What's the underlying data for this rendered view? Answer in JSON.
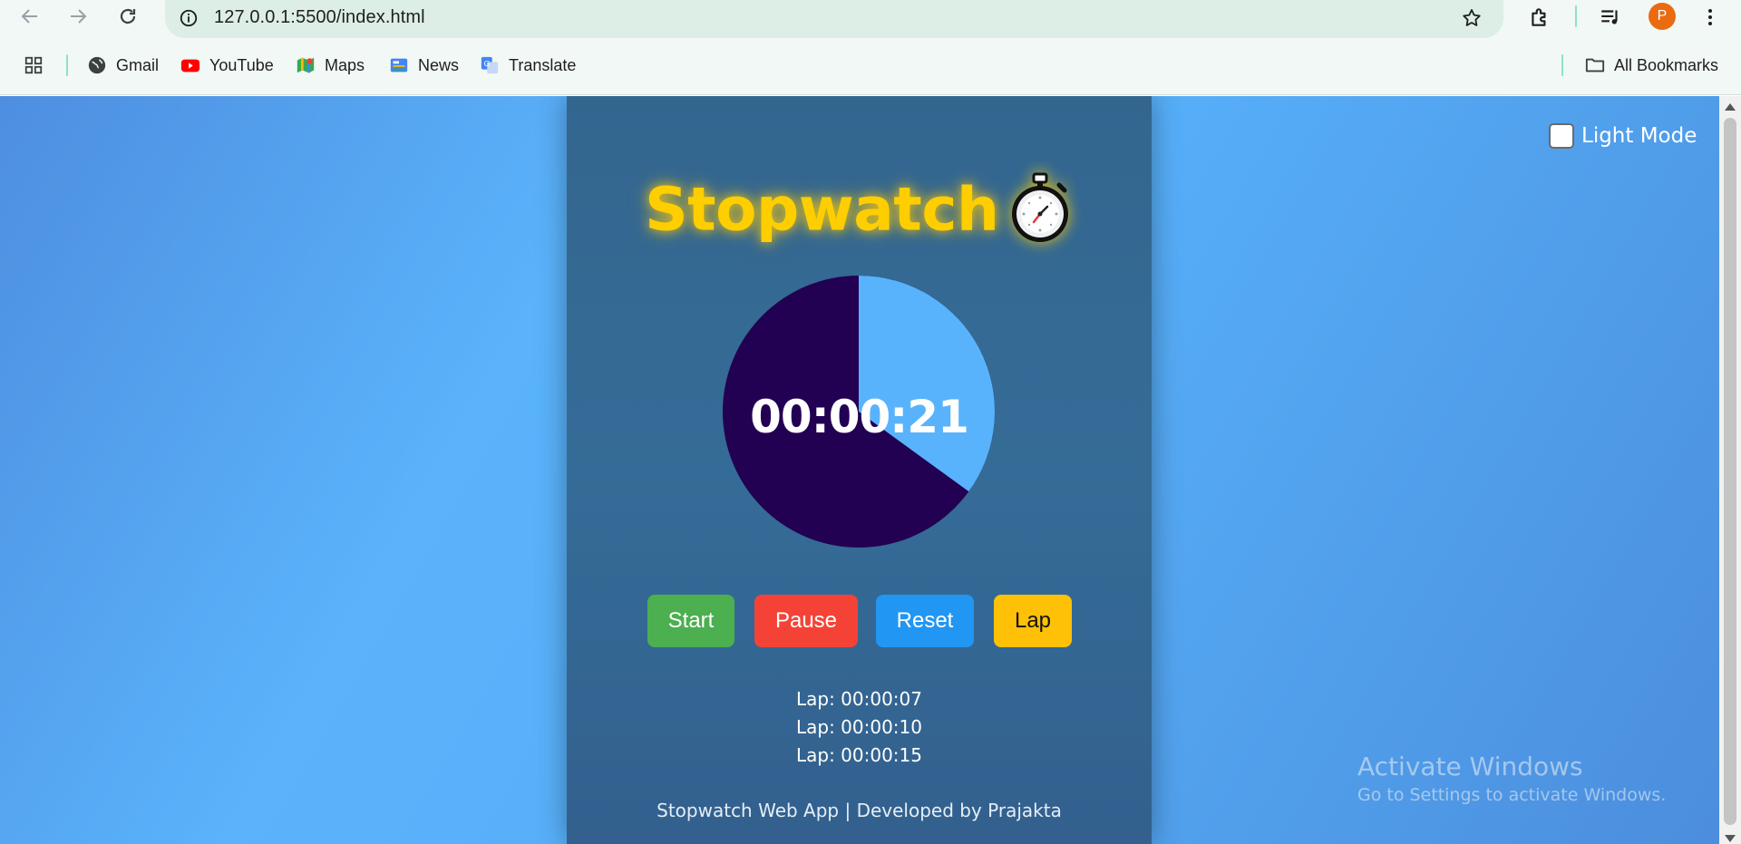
{
  "browser": {
    "url": "127.0.0.1:5500/index.html",
    "avatar_letter": "P",
    "bookmarks": [
      {
        "label": "Gmail",
        "icon": "globe-icon"
      },
      {
        "label": "YouTube",
        "icon": "youtube-icon"
      },
      {
        "label": "Maps",
        "icon": "maps-icon"
      },
      {
        "label": "News",
        "icon": "news-icon"
      },
      {
        "label": "Translate",
        "icon": "translate-icon"
      }
    ],
    "all_bookmarks": "All Bookmarks"
  },
  "app": {
    "title": "Stopwatch",
    "title_icon": "stopwatch-icon",
    "time": "00:00:21",
    "dial_progress_fraction": 0.35,
    "buttons": {
      "start": "Start",
      "pause": "Pause",
      "reset": "Reset",
      "lap": "Lap"
    },
    "laps": [
      "Lap: 00:00:07",
      "Lap: 00:00:10",
      "Lap: 00:00:15"
    ],
    "footer": "Stopwatch Web App | Developed by Prajakta",
    "mode_toggle_label": "Light Mode",
    "mode_toggle_checked": false
  },
  "colors": {
    "title": "#ffce00",
    "dial_filled": "#58b3fc",
    "dial_remaining": "#220052",
    "start": "#4caf50",
    "pause": "#f44336",
    "reset": "#2196f3",
    "lap": "#ffc107"
  },
  "os_watermark": {
    "title": "Activate Windows",
    "subtitle": "Go to Settings to activate Windows."
  }
}
